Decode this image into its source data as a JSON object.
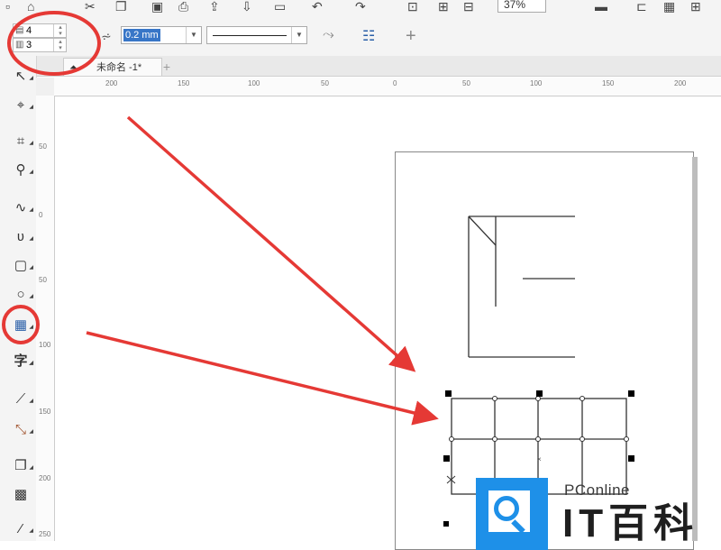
{
  "app": {
    "zoom_value": "37%"
  },
  "property_bar": {
    "rows_value": "4",
    "cols_value": "3",
    "outline_width": "0.2 mm",
    "add_label": "+"
  },
  "tabs": {
    "document_tab_label": "未命名 -1*",
    "add_tab_label": "+"
  },
  "rulers": {
    "horizontal_labels": [
      "200",
      "150",
      "100",
      "50",
      "0",
      "50",
      "100",
      "150",
      "200"
    ],
    "vertical_labels": [
      "50",
      "0",
      "50",
      "100",
      "150",
      "200",
      "250"
    ]
  },
  "toolbox": {
    "items": [
      {
        "name": "pick-tool-icon",
        "glyph": "↖"
      },
      {
        "name": "shape-tool-icon",
        "glyph": "⌖"
      },
      {
        "name": "crop-tool-icon",
        "glyph": "⌗"
      },
      {
        "name": "zoom-tool-icon",
        "glyph": "⚲"
      },
      {
        "name": "freehand-tool-icon",
        "glyph": "∿"
      },
      {
        "name": "artistic-media-tool-icon",
        "glyph": "ʋ"
      },
      {
        "name": "rectangle-tool-icon",
        "glyph": "▢"
      },
      {
        "name": "ellipse-tool-icon",
        "glyph": "○"
      },
      {
        "name": "table-tool-icon",
        "glyph": "▦"
      },
      {
        "name": "text-tool-icon",
        "glyph": "字"
      },
      {
        "name": "parallel-dimension-tool-icon",
        "glyph": "⟋"
      },
      {
        "name": "connector-tool-icon",
        "glyph": "⤡"
      },
      {
        "name": "drop-shadow-tool-icon",
        "glyph": "❐"
      },
      {
        "name": "transparency-tool-icon",
        "glyph": "▩"
      },
      {
        "name": "eyedropper-tool-icon",
        "glyph": "⁄"
      }
    ]
  },
  "watermark": {
    "brand": "PConline",
    "brand_cn": "IT百科"
  },
  "annotation_colors": {
    "highlight": "#e53935",
    "selection_handle": "#000000",
    "logo_blue": "#1e90e8"
  }
}
